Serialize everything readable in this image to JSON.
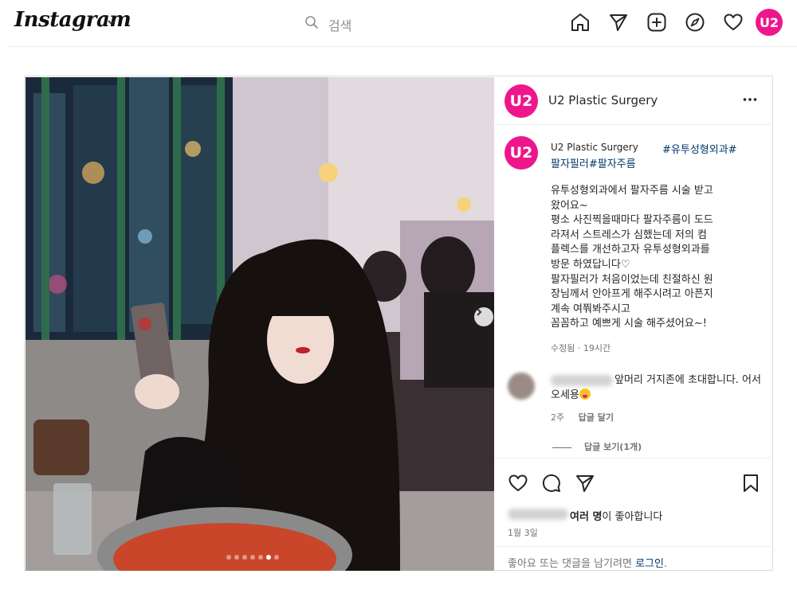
{
  "topnav": {
    "logo": "Instagram",
    "search_placeholder": "검색",
    "avatar_text": "U2",
    "icons": [
      "home-icon",
      "direct-icon",
      "new-post-icon",
      "explore-icon",
      "activity-heart-icon"
    ]
  },
  "post": {
    "account_name": "U2 Plastic Surgery",
    "avatar_text": "U2",
    "caption": {
      "username": "U2 Plastic Surgery",
      "hashtags_line1": "#유투성형외과#",
      "hashtags_line2": "팔자필러#팔자주름",
      "body": "유투성형외과에서 팔자주름 시술 받고\n왔어요~\n평소 사진찍을때마다 팔자주름이 도드\n라져서 스트레스가 심했는데 저의 컴\n플렉스를 개선하고자 유투성형외과를\n방문 하였답니다♡\n팔자필러가 처음이었는데 친절하신 원\n장님께서 안아프게 해주시려고 아픈지\n계속 여쭤봐주시고\n꼼꼼하고 예쁘게 시술 해주셨어요~!",
      "meta": "수정됨 · 19시간"
    },
    "comment": {
      "text": "앞머리 거지존에 초대합니다. 어서오세용",
      "time": "2주",
      "reply_label": "답글 달기",
      "view_replies": "답글 보기(1개)"
    },
    "likes_text": "여러 명이 좋아합니다",
    "likes_bold": "여러 명",
    "likes_rest": "이 좋아합니다",
    "date": "1월 3일",
    "login_prompt": "좋아요 또는 댓글을 남기려면",
    "login_link": "로그인",
    "login_period": ".",
    "carousel": {
      "total": 7,
      "active_index": 5
    }
  },
  "colors": {
    "brand_pink": "#ee168a",
    "link_blue": "#00376b",
    "muted": "#737373"
  }
}
